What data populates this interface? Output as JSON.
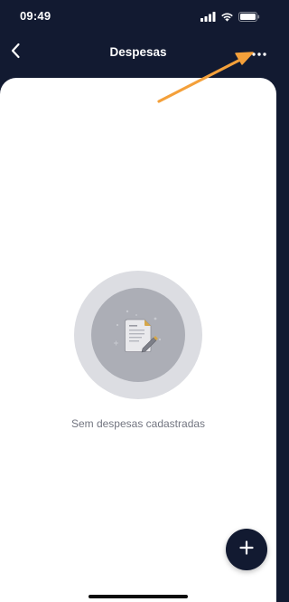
{
  "status_bar": {
    "time": "09:49",
    "icons": [
      "cellular-signal-icon",
      "wifi-icon",
      "battery-icon"
    ]
  },
  "nav": {
    "title": "Despesas",
    "back_icon": "chevron-left-icon",
    "more_icon": "more-horizontal-icon"
  },
  "empty_state": {
    "message": "Sem despesas cadastradas",
    "icon": "document-edit-icon"
  },
  "fab": {
    "icon": "plus-icon"
  },
  "colors": {
    "header_bg": "#121a31",
    "content_bg": "#ffffff",
    "illustration_outer": "#dcdde2",
    "illustration_inner": "#acaeb6",
    "annotation_arrow": "#f4a03a"
  }
}
